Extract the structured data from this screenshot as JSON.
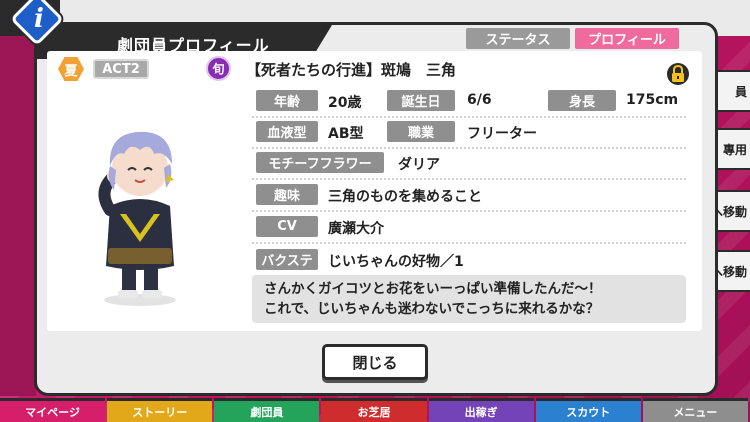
{
  "modal": {
    "title": "劇団員プロフィール",
    "info_glyph": "i",
    "tabs": {
      "status": "ステータス",
      "profile": "プロフィール"
    },
    "close_label": "閉じる"
  },
  "character": {
    "season": "夏",
    "act": "ACT2",
    "shun": "旬",
    "name": "【死者たちの行進】斑鳩　三角"
  },
  "profile": {
    "age_label": "年齢",
    "age_value": "20歳",
    "birthday_label": "誕生日",
    "birthday_value": "6/6",
    "height_label": "身長",
    "height_value": "175cm",
    "blood_label": "血液型",
    "blood_value": "AB型",
    "job_label": "職業",
    "job_value": "フリーター",
    "flower_label": "モチーフフラワー",
    "flower_value": "ダリア",
    "hobby_label": "趣味",
    "hobby_value": "三角のものを集めること",
    "cv_label": "CV",
    "cv_value": "廣瀬大介",
    "backstage_label": "バクステ",
    "backstage_value": "じいちゃんの好物／1",
    "comment_line1": "さんかくガイコツとお花をいーっぱい準備したんだ～！",
    "comment_line2": "これで、じいちゃんも迷わないでこっちに来れるかな？"
  },
  "background": {
    "side_buttons": [
      "員",
      "專用",
      "へ移動",
      "へ移動"
    ],
    "nav": [
      "マイページ",
      "ストーリー",
      "劇団員",
      "お芝居",
      "出稼ぎ",
      "スカウト",
      "メニュー"
    ]
  },
  "colors": {
    "accent_pink": "#ef6a9d",
    "tab_gray": "#9a9a9a",
    "info_blue": "#1d5ec9",
    "lock_yellow": "#f4c21b"
  },
  "icons": {
    "lock": "lock-icon",
    "info": "info-icon"
  }
}
